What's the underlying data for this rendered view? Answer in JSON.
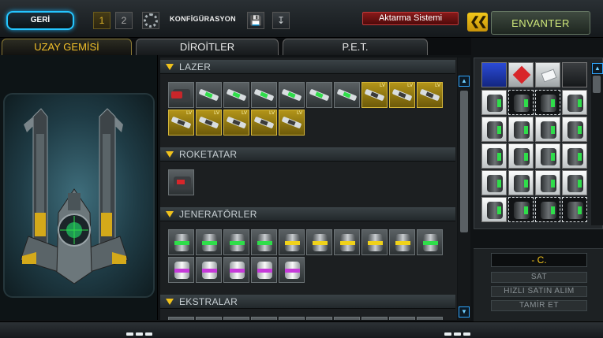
{
  "header": {
    "back_label": "GERİ",
    "config_1": "1",
    "config_2": "2",
    "config_label": "KONFİGÜRASYON",
    "transfer_label": "Aktarma Sistemi",
    "inventory_title": "ENVANTER"
  },
  "tabs": [
    {
      "label": "UZAY GEMİSİ",
      "active": true
    },
    {
      "label": "DİROİTLER",
      "active": false
    },
    {
      "label": "P.E.T.",
      "active": false
    }
  ],
  "sections": {
    "lasers": "LAZER",
    "rockets": "ROKETATAR",
    "generators": "JENERATÖRLER",
    "extras": "EKSTRALAR"
  },
  "slot_level_label": "LV",
  "sell": {
    "price": "- C.",
    "sell_label": "SAT",
    "quick_buy_label": "HIZLI SATIN ALIM",
    "repair_label": "TAMİR ET"
  },
  "colors": {
    "accent_gold": "#f0c21c",
    "accent_blue": "#25c6ff",
    "transfer_red": "#8a1a1a",
    "status_green": "#2fdd4a"
  }
}
